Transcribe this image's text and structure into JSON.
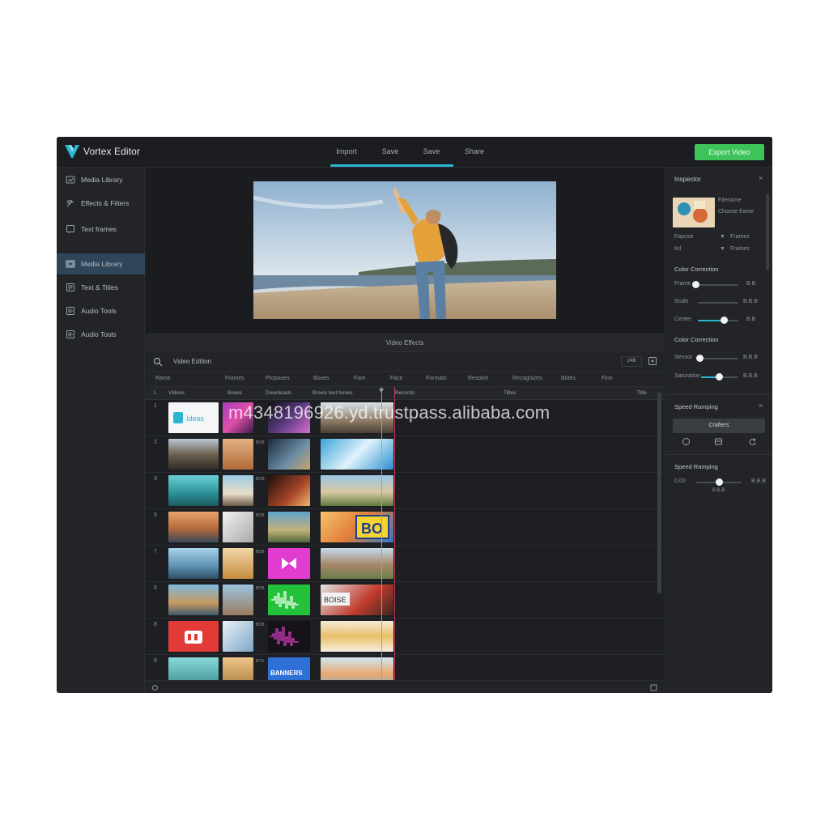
{
  "app": {
    "title": "Vortex Editor",
    "accent": "#2bb6d4",
    "export_color": "#3ec25a"
  },
  "nav": {
    "items": [
      "Import",
      "Save",
      "Save",
      "Share"
    ],
    "export_label": "Export Video"
  },
  "sidebar": {
    "items": [
      {
        "label": "Media Library",
        "icon": "media-icon"
      },
      {
        "label": "Effects & Filters",
        "icon": "effects-icon"
      },
      {
        "label": "Text frames",
        "icon": "text-icon"
      },
      {
        "label": "Media Library",
        "icon": "media-icon",
        "active": true
      },
      {
        "label": "Text & Titles",
        "icon": "titles-icon"
      },
      {
        "label": "Audio Tools",
        "icon": "audio-icon"
      },
      {
        "label": "Audio Tools",
        "icon": "audio-icon"
      }
    ]
  },
  "preview": {
    "caption": "Video Effects"
  },
  "search": {
    "label": "Video Edition",
    "badge": "24B"
  },
  "columns": [
    "Rame",
    "Frames",
    "Proposes",
    "Boxes",
    "Fare",
    "Face",
    "Formats",
    "Resolve",
    "Recognizes",
    "Botes",
    "Fine"
  ],
  "track_header": [
    "Videos",
    "Boxes",
    "Downloads",
    "Boxes text boxes",
    "Records",
    "Titles",
    "Title"
  ],
  "rows": [
    {
      "num": "1",
      "tag": "",
      "mid": ""
    },
    {
      "num": "2",
      "tag": "",
      "mid": "BOB"
    },
    {
      "num": "3",
      "tag": "",
      "mid": "BOB"
    },
    {
      "num": "5",
      "tag": "",
      "mid": "BOB"
    },
    {
      "num": "7",
      "tag": "",
      "mid": "BOB"
    },
    {
      "num": "5",
      "tag": "",
      "mid": "BOB"
    },
    {
      "num": "8",
      "tag": "",
      "mid": "BOB"
    },
    {
      "num": "8",
      "tag": "",
      "mid": "BYS"
    }
  ],
  "thumb_texts": {
    "brand": "Ideas",
    "bo": "BO",
    "boise": "BOISE",
    "banner": "BANNERS"
  },
  "inspector": {
    "title": "Inspector",
    "file_name": "Filename",
    "file_type": "Choose frame",
    "field_label_1": "Fapose",
    "field_value_1": "Frames",
    "field_label_2": "Kd",
    "field_value_2": "Frames",
    "color_title_1": "Color Correction",
    "sliders_1": [
      {
        "label": "Frame",
        "value": "B.B",
        "level": 0.0
      },
      {
        "label": "Scale",
        "value": "B.B.B",
        "level": 0.0
      },
      {
        "label": "Center",
        "value": "B.B",
        "level": 0.65
      }
    ],
    "color_title_2": "Color Correction",
    "sliders_2": [
      {
        "label": "Sensor",
        "value": "B.B.B",
        "level": 0.05
      },
      {
        "label": "Saturation",
        "value": "B.B.B",
        "level": 0.55
      }
    ],
    "speed_title": "Speed Ramping",
    "preset_label": "Crafters",
    "speed_title_2": "Speed Ramping",
    "speed_slider": {
      "label": "0.00",
      "value": "B.B.B",
      "center_label": "B.B.B",
      "level": 0.5
    }
  },
  "watermark": "m4348196926.yd.trustpass.alibaba.com"
}
